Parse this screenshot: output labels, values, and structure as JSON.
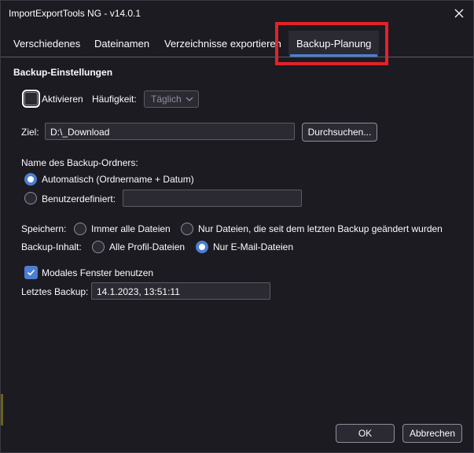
{
  "window": {
    "title": "ImportExportTools NG - v14.0.1"
  },
  "tabs": [
    {
      "label": "Verschiedenes"
    },
    {
      "label": "Dateinamen"
    },
    {
      "label": "Verzeichnisse exportieren"
    },
    {
      "label": "Backup-Planung"
    }
  ],
  "section": {
    "title": "Backup-Einstellungen"
  },
  "activate": {
    "label": "Aktivieren",
    "checked": false
  },
  "frequency": {
    "label": "Häufigkeit:",
    "value": "Täglich"
  },
  "target": {
    "label": "Ziel:",
    "value": "D:\\_Download",
    "browse_label": "Durchsuchen..."
  },
  "folder_name": {
    "label": "Name des Backup-Ordners:",
    "auto_label": "Automatisch (Ordnername + Datum)",
    "custom_label": "Benutzerdefiniert:",
    "custom_value": ""
  },
  "save": {
    "label": "Speichern:",
    "all_label": "Immer alle Dateien",
    "changed_label": "Nur Dateien, die seit dem letzten Backup geändert wurden"
  },
  "content": {
    "label": "Backup-Inhalt:",
    "profile_label": "Alle Profil-Dateien",
    "mail_label": "Nur E-Mail-Dateien"
  },
  "modal": {
    "label": "Modales Fenster benutzen",
    "checked": true
  },
  "last_backup": {
    "label": "Letztes Backup:",
    "value": "14.1.2023, 13:51:11"
  },
  "footer": {
    "ok_label": "OK",
    "cancel_label": "Abbrechen"
  },
  "colors": {
    "accent": "#4b7fd3",
    "highlight": "#e3222a",
    "background": "#1c1b22"
  }
}
